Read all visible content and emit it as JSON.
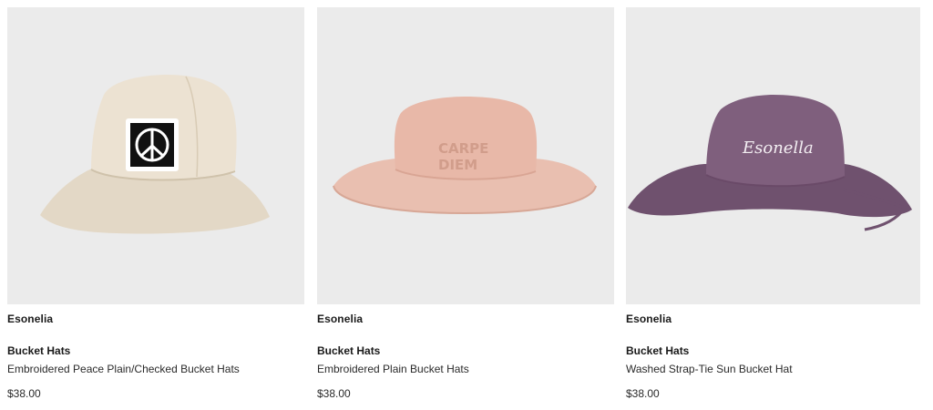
{
  "products": [
    {
      "brand": "Esonelia",
      "category": "Bucket Hats",
      "title": "Embroidered Peace Plain/Checked Bucket Hats",
      "price": "$38.00",
      "image_icon": "cream-bucket-hat-peace-patch",
      "hat_color": "#e8ddcc"
    },
    {
      "brand": "Esonelia",
      "category": "Bucket Hats",
      "title": "Embroidered Plain Bucket Hats",
      "price": "$38.00",
      "image_icon": "pink-wide-brim-hat",
      "hat_color": "#e6b7a8",
      "embroidery_text": [
        "CARPE",
        "DIEM"
      ]
    },
    {
      "brand": "Esonelia",
      "category": "Bucket Hats",
      "title": "Washed Strap-Tie Sun Bucket Hat",
      "price": "$38.00",
      "image_icon": "purple-sun-hat-strap",
      "hat_color": "#7d5c7b",
      "embroidery_text": "Esonella"
    }
  ],
  "colors": {
    "card_background": "#ebebeb",
    "text": "#1a1a1a"
  }
}
